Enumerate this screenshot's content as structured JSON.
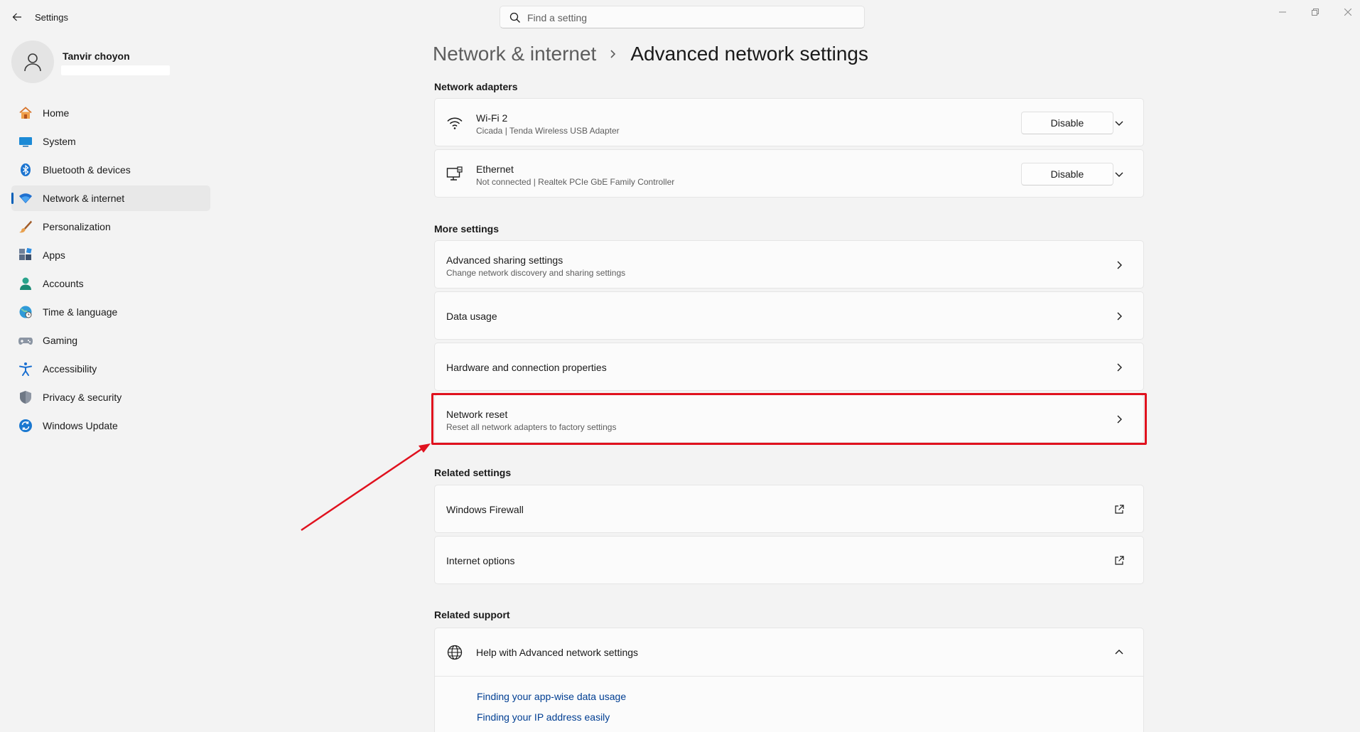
{
  "window": {
    "title": "Settings",
    "search_placeholder": "Find a setting",
    "user_name": "Tanvir choyon"
  },
  "sidebar": {
    "items": [
      {
        "label": "Home",
        "icon": "home-icon"
      },
      {
        "label": "System",
        "icon": "system-icon"
      },
      {
        "label": "Bluetooth & devices",
        "icon": "bluetooth-icon"
      },
      {
        "label": "Network & internet",
        "icon": "wifi-icon",
        "active": true
      },
      {
        "label": "Personalization",
        "icon": "brush-icon"
      },
      {
        "label": "Apps",
        "icon": "apps-icon"
      },
      {
        "label": "Accounts",
        "icon": "accounts-icon"
      },
      {
        "label": "Time & language",
        "icon": "globe-clock-icon"
      },
      {
        "label": "Gaming",
        "icon": "gamepad-icon"
      },
      {
        "label": "Accessibility",
        "icon": "accessibility-icon"
      },
      {
        "label": "Privacy & security",
        "icon": "shield-icon"
      },
      {
        "label": "Windows Update",
        "icon": "update-icon"
      }
    ]
  },
  "breadcrumb": {
    "parent": "Network & internet",
    "current": "Advanced network settings"
  },
  "network_adapters": {
    "heading": "Network adapters",
    "items": [
      {
        "name": "Wi-Fi 2",
        "detail": "Cicada | Tenda Wireless USB Adapter",
        "button": "Disable",
        "icon": "wifi-icon"
      },
      {
        "name": "Ethernet",
        "detail": "Not connected | Realtek PCIe GbE Family Controller",
        "button": "Disable",
        "icon": "ethernet-icon"
      }
    ]
  },
  "more_settings": {
    "heading": "More settings",
    "items": [
      {
        "title": "Advanced sharing settings",
        "sub": "Change network discovery and sharing settings"
      },
      {
        "title": "Data usage",
        "sub": ""
      },
      {
        "title": "Hardware and connection properties",
        "sub": ""
      },
      {
        "title": "Network reset",
        "sub": "Reset all network adapters to factory settings",
        "highlighted": true
      }
    ]
  },
  "related_settings": {
    "heading": "Related settings",
    "items": [
      {
        "title": "Windows Firewall",
        "icon": "external-link-icon"
      },
      {
        "title": "Internet options",
        "icon": "external-link-icon"
      }
    ]
  },
  "related_support": {
    "heading": "Related support",
    "help_title": "Help with Advanced network settings",
    "links": [
      "Finding your app-wise data usage",
      "Finding your IP address easily"
    ]
  },
  "colors": {
    "accent": "#005fb8",
    "annotation_red": "#e0111e",
    "link": "#003e92"
  }
}
